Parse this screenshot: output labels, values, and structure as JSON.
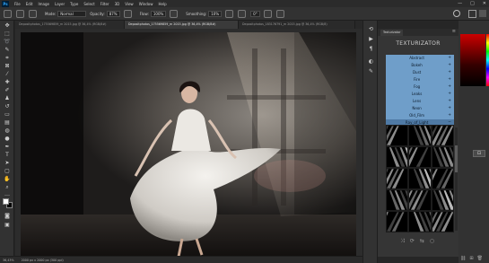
{
  "app": {
    "logo": "Ps"
  },
  "menu": [
    "File",
    "Edit",
    "Image",
    "Layer",
    "Type",
    "Select",
    "Filter",
    "3D",
    "View",
    "Window",
    "Help"
  ],
  "window_controls": [
    "—",
    "□",
    "✕"
  ],
  "options": {
    "mode_label": "Mode:",
    "mode_value": "Normal",
    "opacity_label": "Opacity:",
    "opacity_value": "87%",
    "flow_label": "Flow:",
    "flow_value": "100%",
    "smoothing_label": "Smoothing:",
    "smoothing_value": "10%",
    "angle_value": "0°"
  },
  "tabs": [
    {
      "label": "Depositphotos_175569859_m 2015.jpg @ 36,4% (RGB/8#)",
      "active": false
    },
    {
      "label": "Depositphotos_175569859_m 2015.jpg @ 36,4% (RGB/8#)",
      "active": true
    },
    {
      "label": "Depositphotos_183176791_m 2015.jpg @ 36,4% (RGB/8)",
      "active": false
    }
  ],
  "status": {
    "zoom": "36,43%",
    "doc": "2000 px x 2000 px (300 ppi)"
  },
  "panel": {
    "tab_label": "Texturizator",
    "brand": "TEXTURIZATOR",
    "categories": [
      {
        "label": "Abstract",
        "open": false
      },
      {
        "label": "Bokeh",
        "open": false
      },
      {
        "label": "Dust",
        "open": false
      },
      {
        "label": "Fire",
        "open": false
      },
      {
        "label": "Fog",
        "open": false
      },
      {
        "label": "Leaks",
        "open": false
      },
      {
        "label": "Lens",
        "open": false
      },
      {
        "label": "Neon",
        "open": false
      },
      {
        "label": "Old_Film",
        "open": false
      },
      {
        "label": "Ray_of_Light",
        "open": true
      }
    ],
    "open_marker": "−",
    "closed_marker": "+",
    "thumbnail_count": 15
  },
  "colors": {
    "accent_blue": "#6f9ec9",
    "panel_bg": "#353535",
    "ps_blue": "#31a8ff"
  }
}
